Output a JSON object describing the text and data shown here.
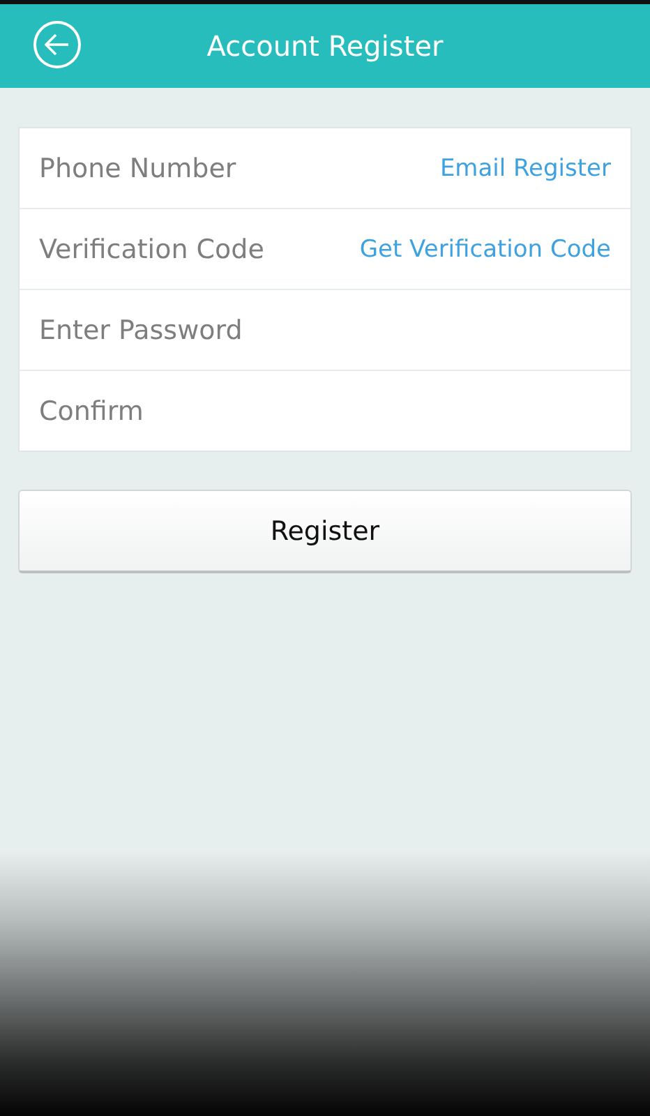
{
  "header": {
    "title": "Account Register"
  },
  "form": {
    "fields": [
      {
        "placeholder": "Phone Number",
        "link": "Email Register"
      },
      {
        "placeholder": "Verification Code",
        "link": "Get Verification Code"
      },
      {
        "placeholder": "Enter Password"
      },
      {
        "placeholder": "Confirm"
      }
    ]
  },
  "buttons": [
    "Register"
  ]
}
